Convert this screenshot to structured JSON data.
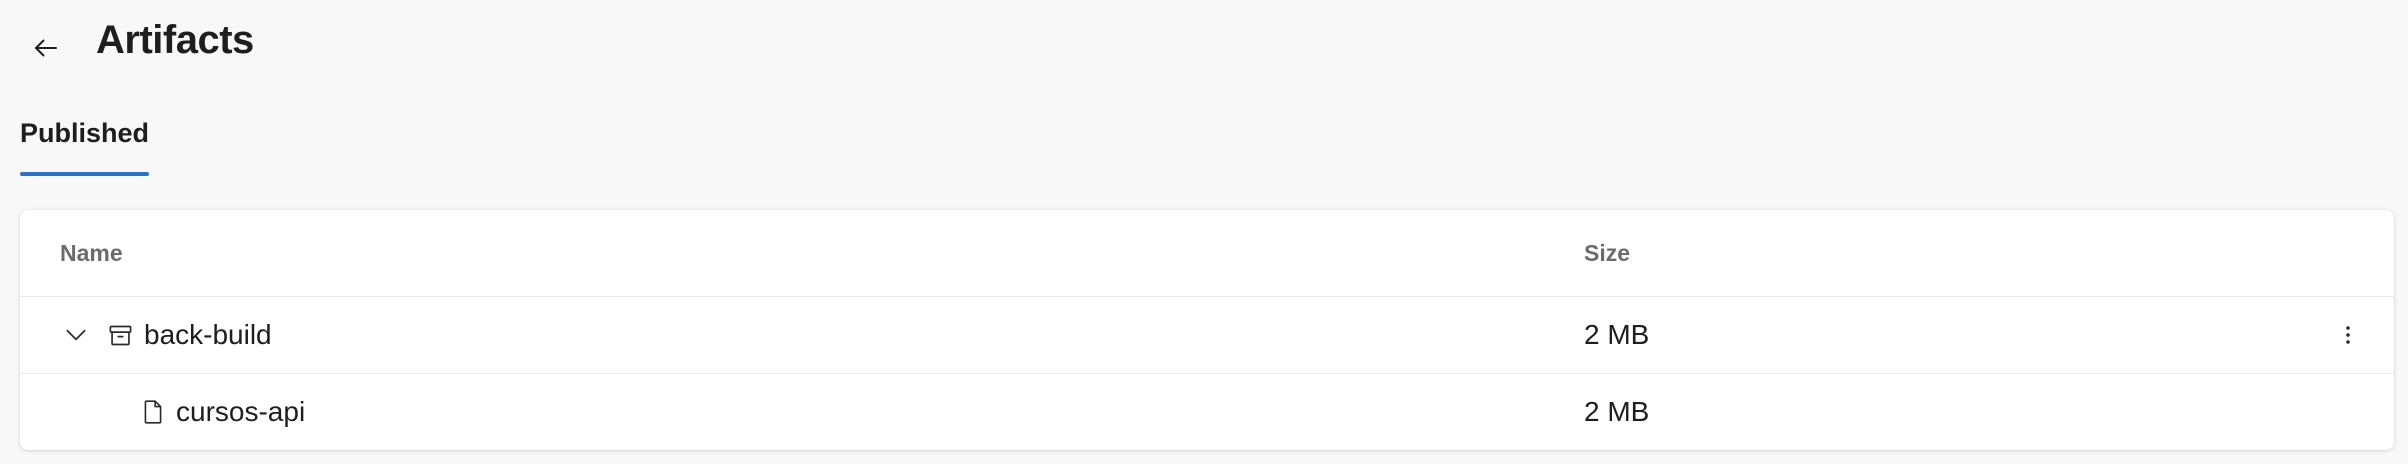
{
  "header": {
    "title": "Artifacts",
    "back_icon": "arrow-left-icon"
  },
  "tabs": [
    {
      "label": "Published",
      "selected": true
    }
  ],
  "accent_color": "#2f6fc6",
  "table": {
    "columns": [
      "Name",
      "Size"
    ],
    "rows": [
      {
        "name": "back-build",
        "size": "2 MB",
        "icon": "archive-icon",
        "expanded": true,
        "level": 0,
        "has_more_menu": true
      },
      {
        "name": "cursos-api",
        "size": "2 MB",
        "icon": "file-icon",
        "level": 1
      }
    ]
  }
}
